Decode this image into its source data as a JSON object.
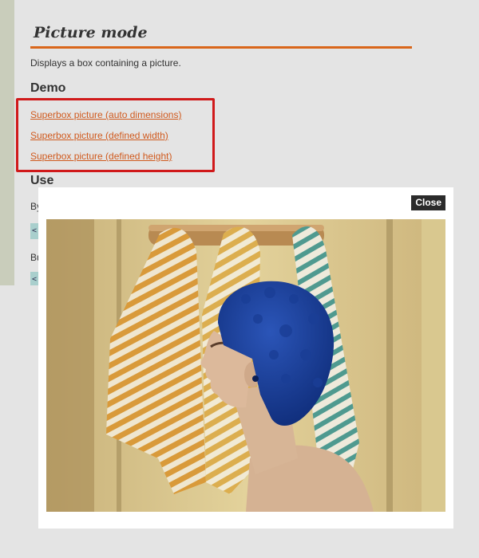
{
  "section": {
    "title": "Picture mode",
    "description": "Displays a box containing a picture.",
    "demo_heading": "Demo",
    "use_heading": "Use"
  },
  "demo_links": [
    "Superbox picture (auto dimensions)",
    "Superbox picture (defined width)",
    "Superbox picture (defined height)"
  ],
  "partially_visible": {
    "text1": "By",
    "text2": "Bu",
    "chip1": "<",
    "chip2": "<"
  },
  "superbox": {
    "close_label": "Close",
    "image_subject": "man-in-blue-knit-hat-photo"
  },
  "colors": {
    "accent_orange": "#d9661a",
    "link": "#d05a1e",
    "highlight_red": "#d0191a",
    "close_bg": "#2b2b2b"
  }
}
